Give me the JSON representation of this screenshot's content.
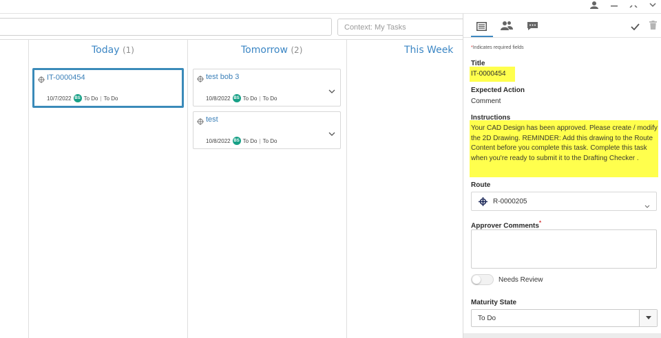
{
  "context_search": {
    "placeholder": "Context: My Tasks"
  },
  "columns": [
    {
      "title": "Today",
      "count": "(1)"
    },
    {
      "title": "Tomorrow",
      "count": "(2)"
    },
    {
      "title": "This Week",
      "count": ""
    }
  ],
  "cards": [
    {
      "id": "IT-0000454",
      "date": "10/7/2022",
      "avatar": "BS",
      "status1": "To Do",
      "status2": "To Do"
    },
    {
      "id": "test bob 3",
      "date": "10/8/2022",
      "avatar": "BS",
      "status1": "To Do",
      "status2": "To Do"
    },
    {
      "id": "test",
      "date": "10/8/2022",
      "avatar": "BS",
      "status1": "To Do",
      "status2": "To Do"
    }
  ],
  "panel": {
    "required_note": "Indicates required fields",
    "required_mark": "*",
    "title_label": "Title",
    "title_value": "IT-0000454",
    "expected_action_label": "Expected Action",
    "expected_action_value": "Comment",
    "instructions_label": "Instructions",
    "instructions_value": "Your CAD Design has been approved. Please create / modify the 2D Drawing. REMINDER: Add this drawing to the Route Content before you complete this task. Complete this task when you're ready to submit it to the Drafting Checker .",
    "route_label": "Route",
    "route_value": "R-0000205",
    "approver_comments_label": "Approver Comments",
    "needs_review_label": "Needs Review",
    "maturity_state_label": "Maturity State",
    "maturity_state_value": "To Do"
  },
  "colors": {
    "accent": "#3b86c4",
    "highlight": "#ffff4d",
    "avatar": "#17a086"
  }
}
